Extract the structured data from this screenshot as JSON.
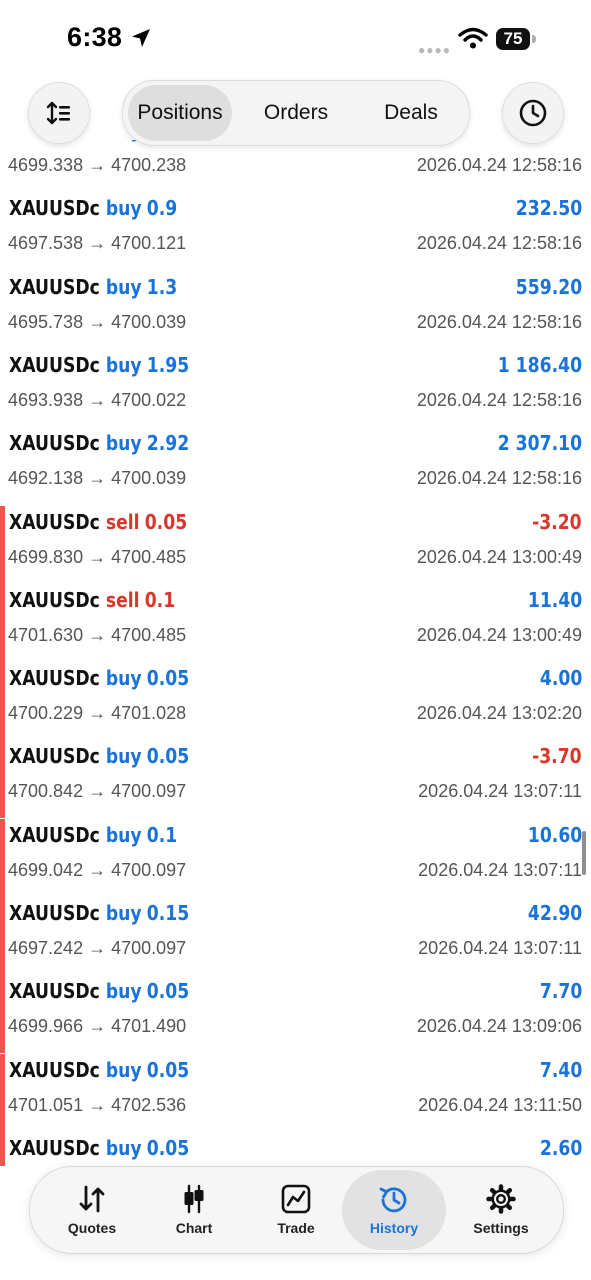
{
  "status_bar": {
    "time": "6:38",
    "battery": "75"
  },
  "header": {
    "sort_icon": "sort-icon",
    "segments": [
      {
        "label": "Positions",
        "active": true
      },
      {
        "label": "Orders",
        "active": false
      },
      {
        "label": "Deals",
        "active": false
      }
    ],
    "history_icon": "clock-icon"
  },
  "colors": {
    "buy": "#1a73d9",
    "sell": "#d9372b",
    "side_bar": "#e25b4d",
    "active_tab": "#1a73d9"
  },
  "list": [
    {
      "symbol": "XAUUSDc",
      "action": "buy",
      "volume": "",
      "profit": "",
      "open": "4699.338",
      "close": "4700.238",
      "datetime": "2026.04.24 12:58:16",
      "bar": false
    },
    {
      "symbol": "XAUUSDc",
      "action": "buy",
      "volume": "0.9",
      "profit": "232.50",
      "open": "4697.538",
      "close": "4700.121",
      "datetime": "2026.04.24 12:58:16",
      "bar": false
    },
    {
      "symbol": "XAUUSDc",
      "action": "buy",
      "volume": "1.3",
      "profit": "559.20",
      "open": "4695.738",
      "close": "4700.039",
      "datetime": "2026.04.24 12:58:16",
      "bar": false
    },
    {
      "symbol": "XAUUSDc",
      "action": "buy",
      "volume": "1.95",
      "profit": "1 186.40",
      "open": "4693.938",
      "close": "4700.022",
      "datetime": "2026.04.24 12:58:16",
      "bar": false
    },
    {
      "symbol": "XAUUSDc",
      "action": "buy",
      "volume": "2.92",
      "profit": "2 307.10",
      "open": "4692.138",
      "close": "4700.039",
      "datetime": "2026.04.24 12:58:16",
      "bar": false
    },
    {
      "symbol": "XAUUSDc",
      "action": "sell",
      "volume": "0.05",
      "profit": "-3.20",
      "open": "4699.830",
      "close": "4700.485",
      "datetime": "2026.04.24 13:00:49",
      "bar": true
    },
    {
      "symbol": "XAUUSDc",
      "action": "sell",
      "volume": "0.1",
      "profit": "11.40",
      "open": "4701.630",
      "close": "4700.485",
      "datetime": "2026.04.24 13:00:49",
      "bar": true
    },
    {
      "symbol": "XAUUSDc",
      "action": "buy",
      "volume": "0.05",
      "profit": "4.00",
      "open": "4700.229",
      "close": "4701.028",
      "datetime": "2026.04.24 13:02:20",
      "bar": true
    },
    {
      "symbol": "XAUUSDc",
      "action": "buy",
      "volume": "0.05",
      "profit": "-3.70",
      "open": "4700.842",
      "close": "4700.097",
      "datetime": "2026.04.24 13:07:11",
      "bar": true
    },
    {
      "symbol": "XAUUSDc",
      "action": "buy",
      "volume": "0.1",
      "profit": "10.60",
      "open": "4699.042",
      "close": "4700.097",
      "datetime": "2026.04.24 13:07:11",
      "bar": true
    },
    {
      "symbol": "XAUUSDc",
      "action": "buy",
      "volume": "0.15",
      "profit": "42.90",
      "open": "4697.242",
      "close": "4700.097",
      "datetime": "2026.04.24 13:07:11",
      "bar": true
    },
    {
      "symbol": "XAUUSDc",
      "action": "buy",
      "volume": "0.05",
      "profit": "7.70",
      "open": "4699.966",
      "close": "4701.490",
      "datetime": "2026.04.24 13:09:06",
      "bar": true
    },
    {
      "symbol": "XAUUSDc",
      "action": "buy",
      "volume": "0.05",
      "profit": "7.40",
      "open": "4701.051",
      "close": "4702.536",
      "datetime": "2026.04.24 13:11:50",
      "bar": true
    },
    {
      "symbol": "XAUUSDc",
      "action": "buy",
      "volume": "0.05",
      "profit": "2.60",
      "open": "",
      "close": "",
      "datetime": "",
      "bar": true
    }
  ],
  "tabs": [
    {
      "label": "Quotes",
      "icon": "quotes-icon",
      "active": false
    },
    {
      "label": "Chart",
      "icon": "candlestick-chart-icon",
      "active": false
    },
    {
      "label": "Trade",
      "icon": "trade-chart-icon",
      "active": false
    },
    {
      "label": "History",
      "icon": "history-icon",
      "active": true
    },
    {
      "label": "Settings",
      "icon": "gear-icon",
      "active": false
    }
  ]
}
